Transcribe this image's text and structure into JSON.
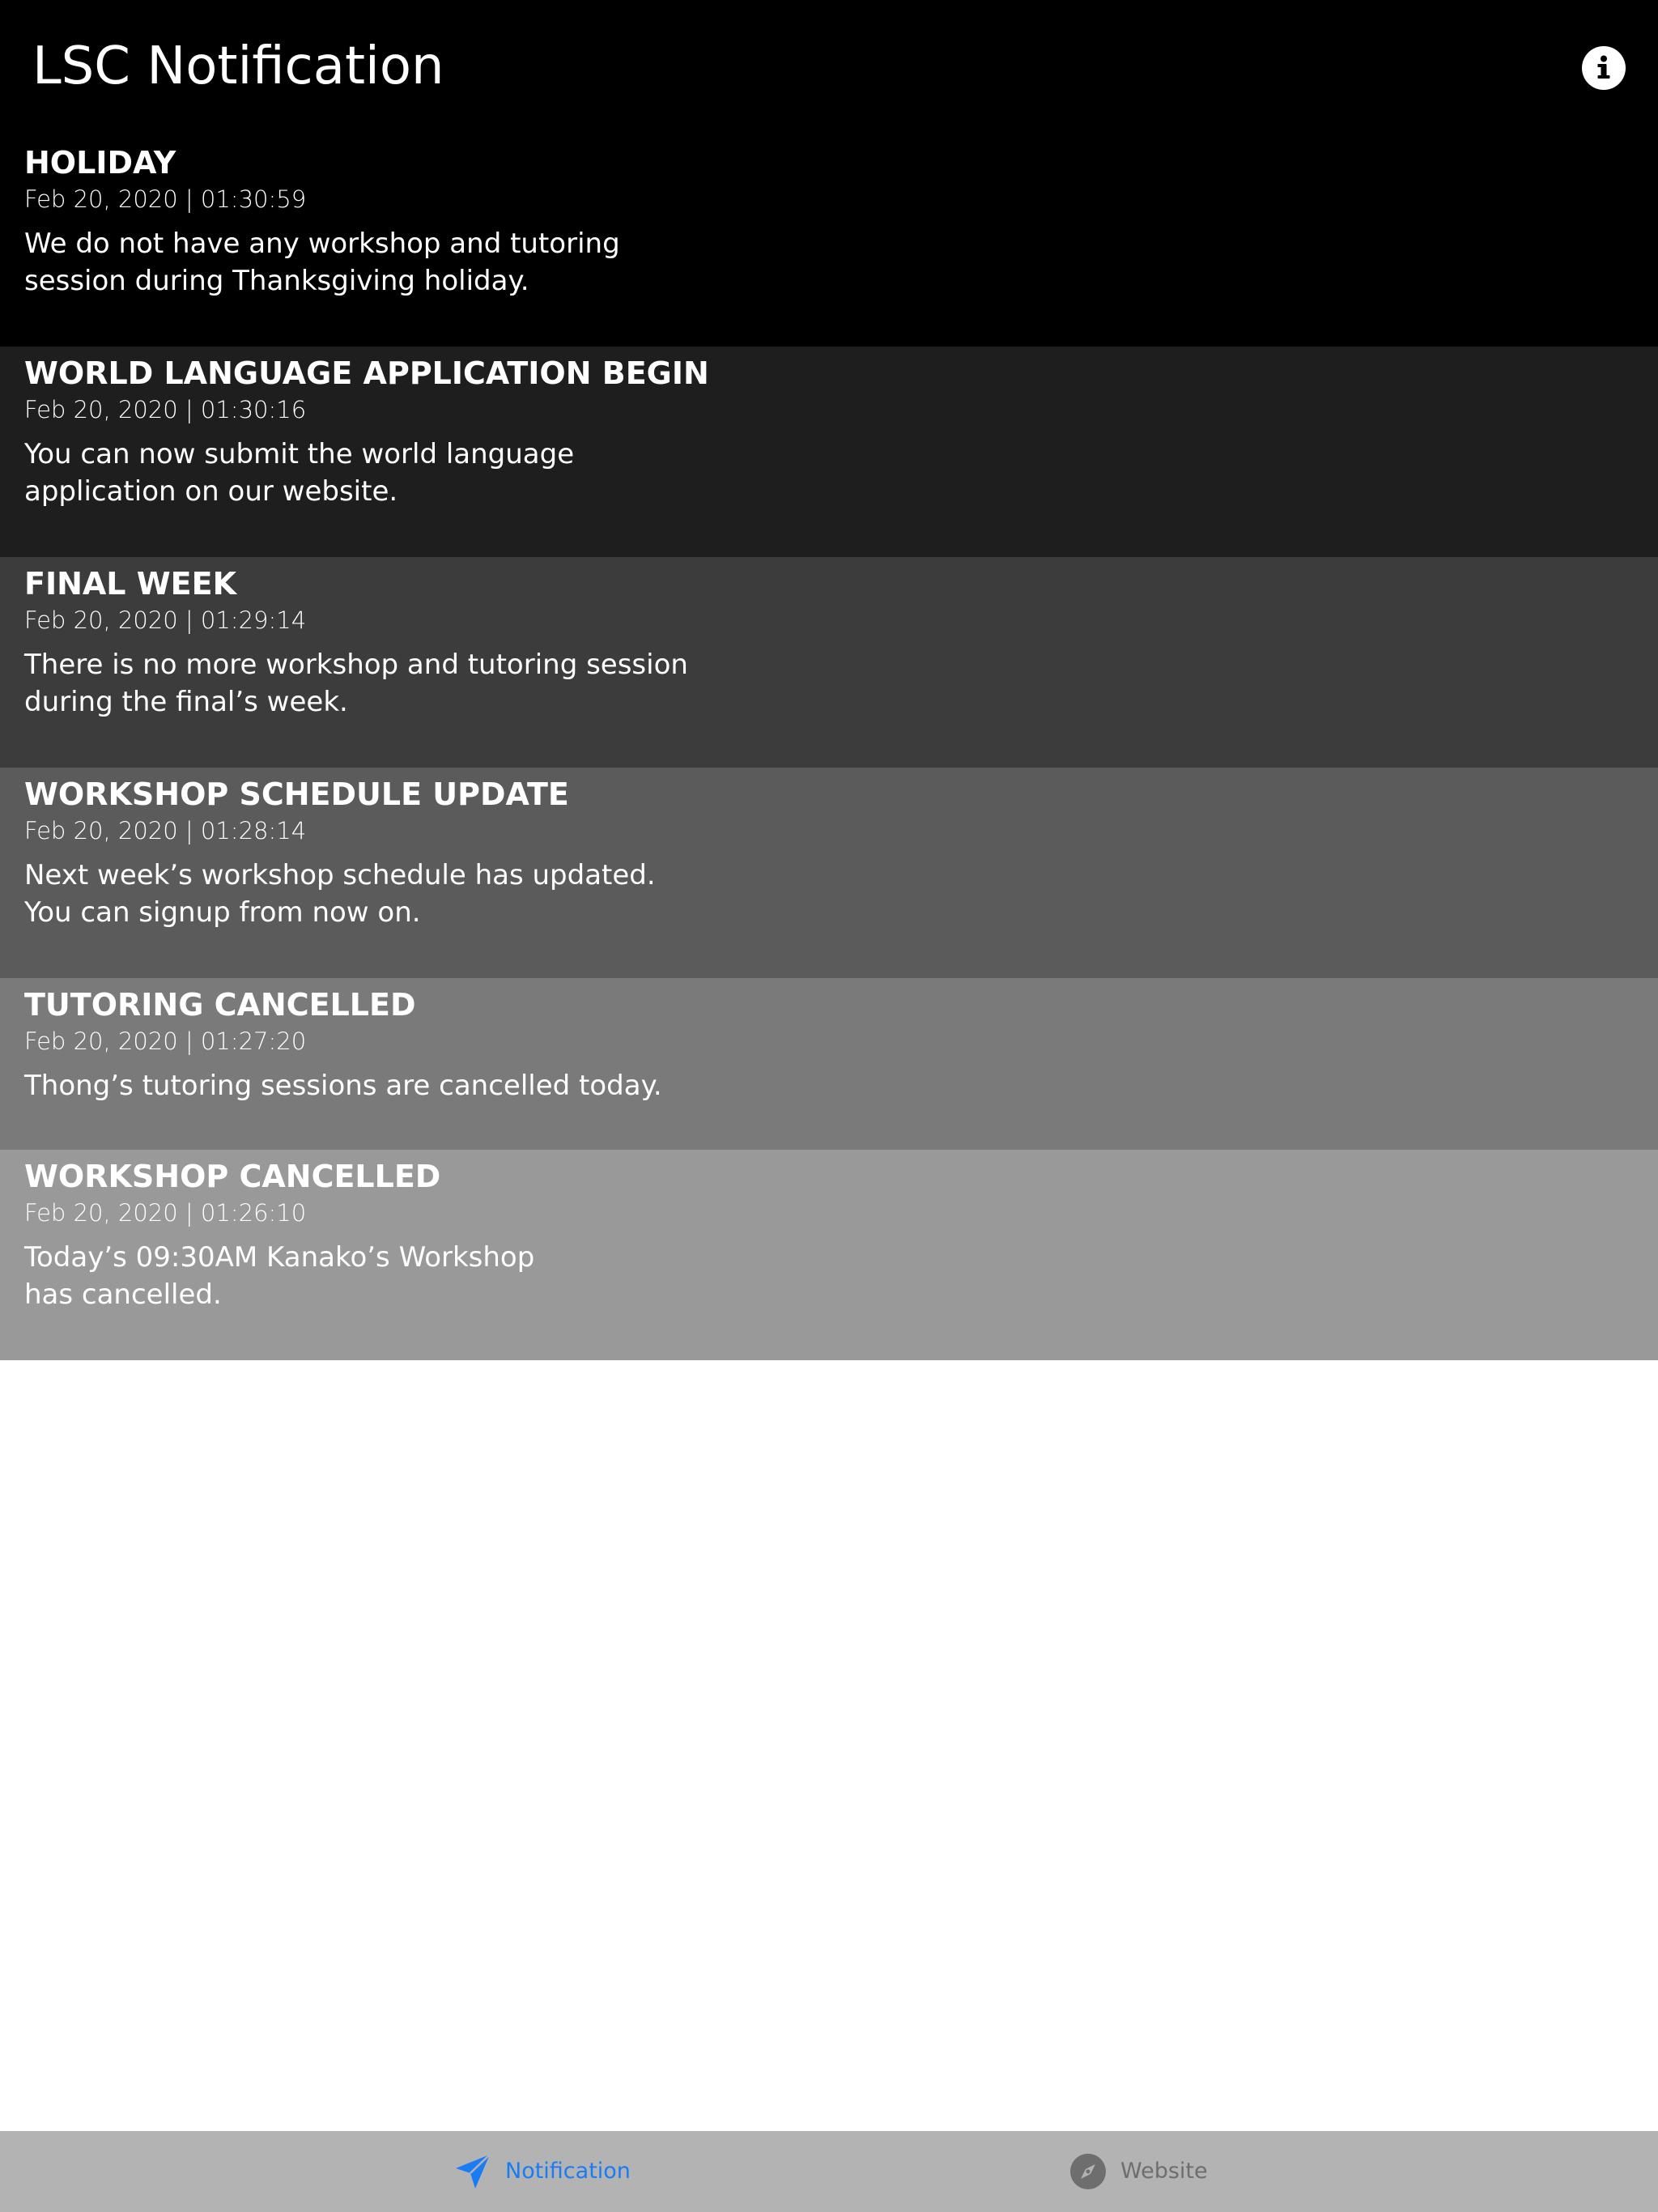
{
  "nav": {
    "title": "LSC Notification",
    "info_icon": "info-icon"
  },
  "notifications": [
    {
      "title": "HOLIDAY",
      "timestamp": "Feb 20, 2020 | 01:30:59",
      "body": "We do not have any workshop and tutoring\nsession during Thanksgiving holiday.",
      "background": "#000000"
    },
    {
      "title": "WORLD LANGUAGE APPLICATION BEGIN",
      "timestamp": "Feb 20, 2020 | 01:30:16",
      "body": "You can now submit the world language\napplication on our website.",
      "background": "#1e1e1e"
    },
    {
      "title": "FINAL WEEK",
      "timestamp": "Feb 20, 2020 | 01:29:14",
      "body": "There is no more workshop and tutoring session\nduring the final’s week.",
      "background": "#3c3c3c"
    },
    {
      "title": "WORKSHOP SCHEDULE UPDATE",
      "timestamp": "Feb 20, 2020 | 01:28:14",
      "body": "Next week’s workshop schedule has updated.\nYou can signup from now on.",
      "background": "#5b5b5b"
    },
    {
      "title": "TUTORING CANCELLED",
      "timestamp": "Feb 20, 2020 | 01:27:20",
      "body": "Thong’s tutoring sessions are cancelled today.",
      "background": "#7a7a7a"
    },
    {
      "title": "WORKSHOP CANCELLED",
      "timestamp": "Feb 20, 2020 | 01:26:10",
      "body": "Today’s 09:30AM Kanako’s Workshop\nhas cancelled.",
      "background": "#999999"
    }
  ],
  "tabbar": {
    "tabs": [
      {
        "label": "Notification",
        "icon": "paper-plane-icon",
        "selected": true,
        "color": "#1a7cf5"
      },
      {
        "label": "Website",
        "icon": "compass-icon",
        "selected": false,
        "color": "#6e6e6e"
      }
    ]
  }
}
